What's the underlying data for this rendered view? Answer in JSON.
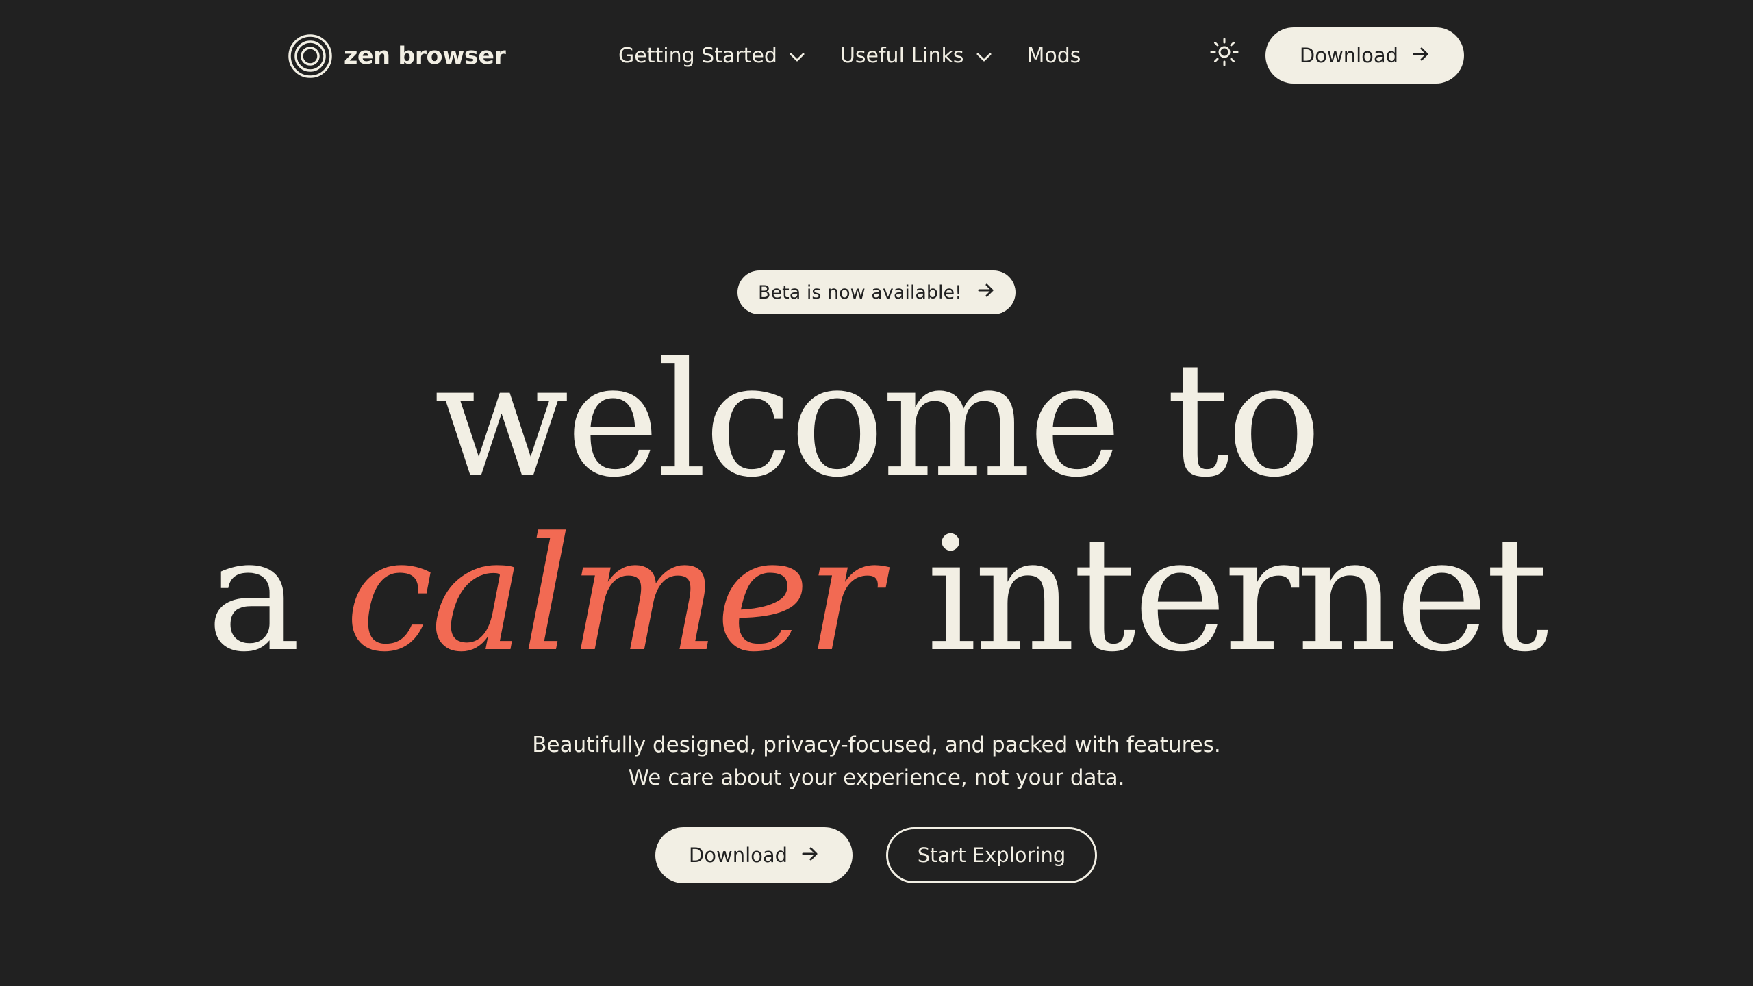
{
  "brand": {
    "name": "zen browser",
    "logo_icon": "concentric-circles-icon"
  },
  "nav": {
    "links": [
      {
        "label": "Getting Started",
        "icon": "chevron-down-icon"
      },
      {
        "label": "Useful Links",
        "icon": "chevron-down-icon"
      },
      {
        "label": "Mods"
      }
    ],
    "theme_icon": "sun-icon",
    "download_label": "Download"
  },
  "hero": {
    "badge_label": "Beta is now available!",
    "headline_line1": "welcome to",
    "headline_line2_prefix": "a ",
    "headline_accent": "calmer",
    "headline_line2_suffix": " internet",
    "subtitle_line1": "Beautifully designed, privacy-focused, and packed with features.",
    "subtitle_line2": "We care about your experience, not your data.",
    "download_label": "Download",
    "explore_label": "Start Exploring"
  },
  "colors": {
    "background": "#212121",
    "foreground": "#f2efe4",
    "accent": "#f26a53"
  }
}
